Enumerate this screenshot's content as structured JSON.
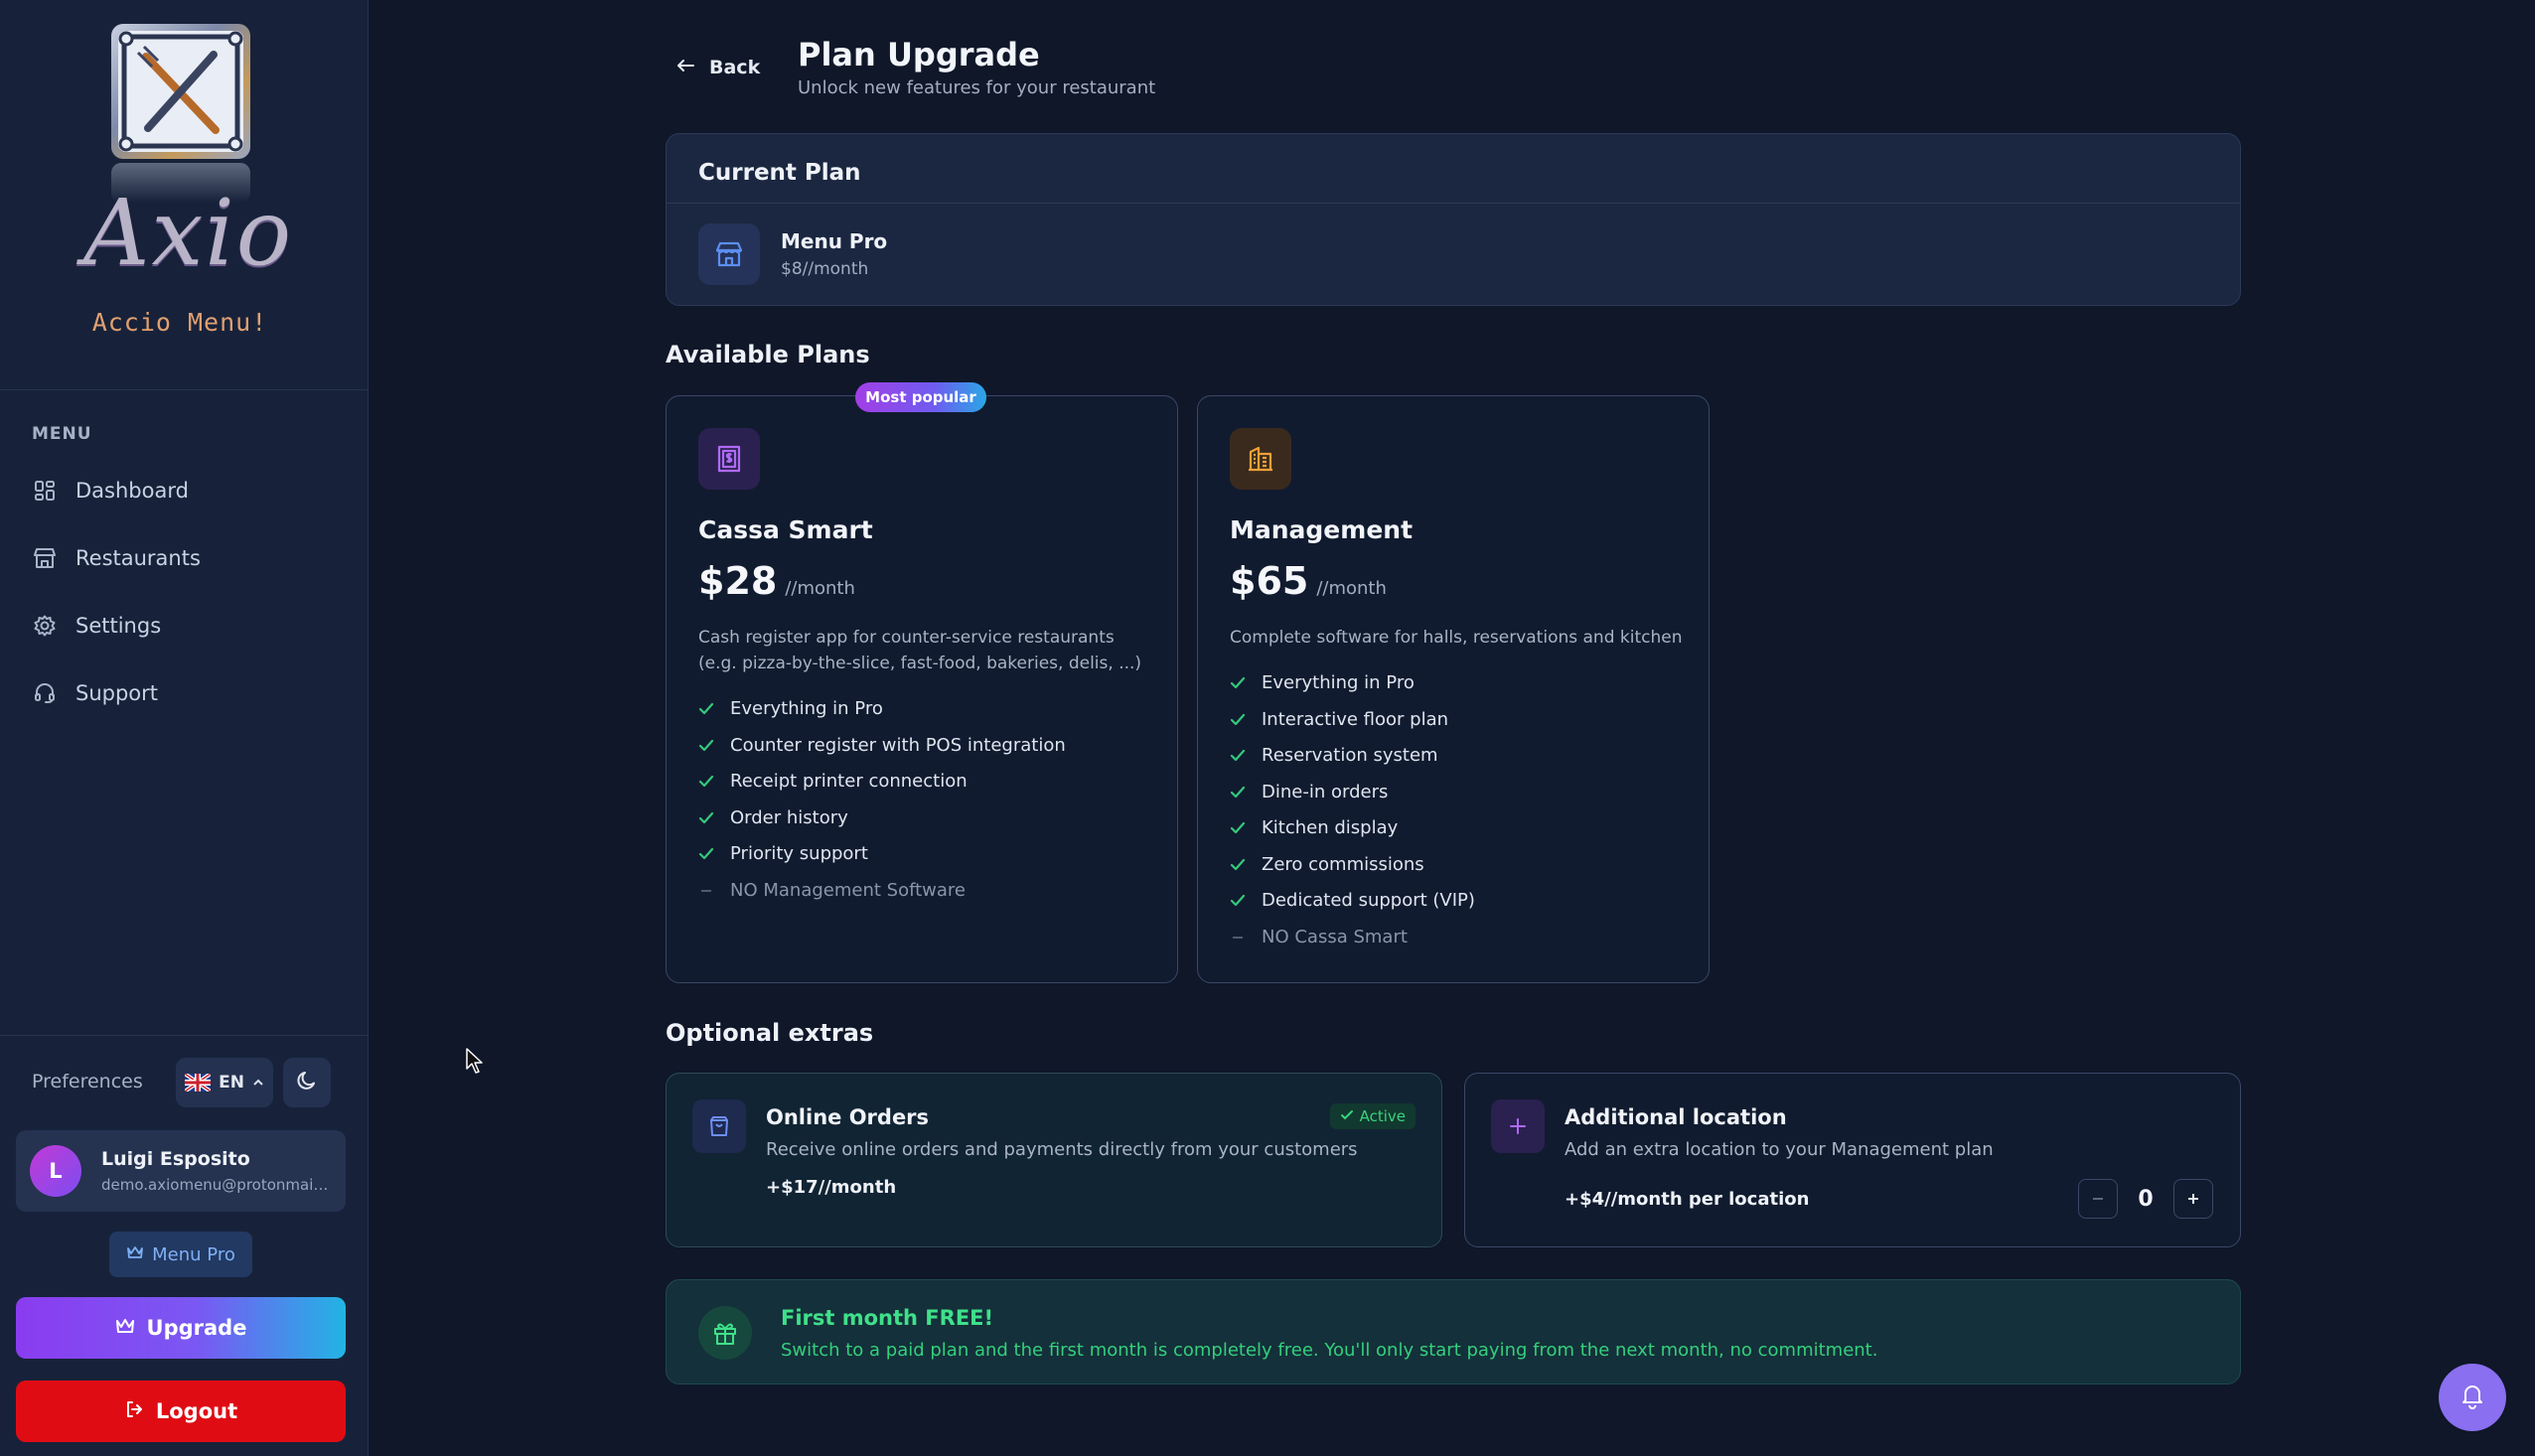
{
  "brand": {
    "logo_text": "Axio",
    "tagline": "Accio Menu!"
  },
  "sidebar": {
    "menu_heading": "MENU",
    "items": [
      {
        "label": "Dashboard",
        "icon": "dashboard-grid-icon"
      },
      {
        "label": "Restaurants",
        "icon": "store-icon"
      },
      {
        "label": "Settings",
        "icon": "gear-icon"
      },
      {
        "label": "Support",
        "icon": "headset-icon"
      }
    ],
    "preferences_label": "Preferences",
    "language": "EN",
    "theme_icon": "moon-icon",
    "user": {
      "initial": "L",
      "name": "Luigi Esposito",
      "email": "demo.axiomenu@protonmail.com"
    },
    "current_plan_badge": "Menu Pro",
    "upgrade_label": "Upgrade",
    "logout_label": "Logout"
  },
  "header": {
    "back_label": "Back",
    "title": "Plan Upgrade",
    "subtitle": "Unlock new features for your restaurant"
  },
  "current_plan": {
    "heading": "Current Plan",
    "name": "Menu Pro",
    "price": "$8//month"
  },
  "available_plans": {
    "heading": "Available Plans",
    "plans": [
      {
        "badge": "Most popular",
        "name": "Cassa Smart",
        "price": "$28",
        "period": "//month",
        "description": "Cash register app for counter-service restaurants (e.g. pizza-by-the-slice, fast-food, bakeries, delis, ...)",
        "features": [
          {
            "text": "Everything in Pro",
            "included": true
          },
          {
            "text": "Counter register with POS integration",
            "included": true
          },
          {
            "text": "Receipt printer connection",
            "included": true
          },
          {
            "text": "Order history",
            "included": true
          },
          {
            "text": "Priority support",
            "included": true
          },
          {
            "text": "NO Management Software",
            "included": false
          }
        ],
        "accent": "#a855f7"
      },
      {
        "name": "Management",
        "price": "$65",
        "period": "//month",
        "description": "Complete software for halls, reservations and kitchen",
        "features": [
          {
            "text": "Everything in Pro",
            "included": true
          },
          {
            "text": "Interactive floor plan",
            "included": true
          },
          {
            "text": "Reservation system",
            "included": true
          },
          {
            "text": "Dine-in orders",
            "included": true
          },
          {
            "text": "Kitchen display",
            "included": true
          },
          {
            "text": "Zero commissions",
            "included": true
          },
          {
            "text": "Dedicated support (VIP)",
            "included": true
          },
          {
            "text": "NO Cassa Smart",
            "included": false
          }
        ],
        "accent": "#f59e0b"
      }
    ]
  },
  "extras": {
    "heading": "Optional extras",
    "online_orders": {
      "title": "Online Orders",
      "description": "Receive online orders and payments directly from your customers",
      "price": "+$17//month",
      "status": "Active"
    },
    "additional_location": {
      "title": "Additional location",
      "description": "Add an extra location to your Management plan",
      "price": "+$4//month per location",
      "quantity": "0"
    }
  },
  "promo": {
    "title": "First month FREE!",
    "text": "Switch to a paid plan and the first month is completely free. You'll only start paying from the next month, no commitment."
  },
  "colors": {
    "background": "#0f1729",
    "sidebar": "#17223a",
    "success": "#39d37f",
    "danger": "#e00c14",
    "primary": "#8a3cf0"
  }
}
